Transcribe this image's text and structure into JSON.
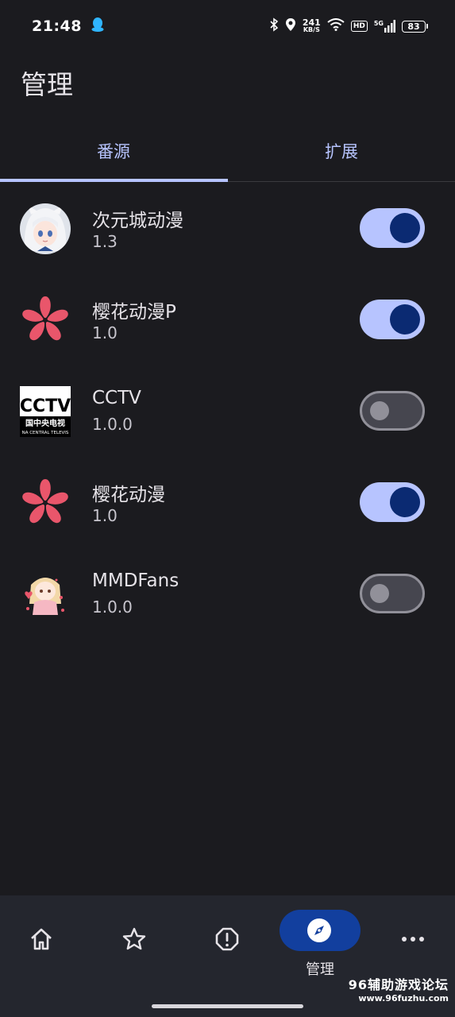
{
  "status_bar": {
    "time": "21:48",
    "net_speed_value": "241",
    "net_speed_unit": "KB/S",
    "hd_badge": "HD",
    "signal_label": "5G",
    "battery": "83"
  },
  "page": {
    "title": "管理"
  },
  "tabs": [
    {
      "label": "番源",
      "selected": true
    },
    {
      "label": "扩展",
      "selected": false
    }
  ],
  "sources": [
    {
      "name": "次元城动漫",
      "version": "1.3",
      "enabled": true,
      "icon": "anime-girl-avatar"
    },
    {
      "name": "樱花动漫P",
      "version": "1.0",
      "enabled": true,
      "icon": "sakura-flower-icon"
    },
    {
      "name": "CCTV",
      "version": "1.0.0",
      "enabled": false,
      "icon": "cctv-logo",
      "logo_text": [
        "CCTV",
        "国中央电视",
        "NA CENTRAL TELEVIS"
      ]
    },
    {
      "name": "樱花动漫",
      "version": "1.0",
      "enabled": true,
      "icon": "sakura-flower-icon"
    },
    {
      "name": "MMDFans",
      "version": "1.0.0",
      "enabled": false,
      "icon": "chibi-girl-avatar"
    }
  ],
  "bottom_nav": [
    {
      "icon": "home-icon",
      "label": ""
    },
    {
      "icon": "star-icon",
      "label": ""
    },
    {
      "icon": "alert-octagon-icon",
      "label": ""
    },
    {
      "icon": "compass-icon",
      "label": "管理",
      "active": true
    },
    {
      "icon": "more-icon",
      "label": ""
    }
  ],
  "watermark": {
    "line1": "96辅助游戏论坛",
    "line2": "www.96fuzhu.com"
  },
  "colors": {
    "background": "#1b1b1f",
    "accent": "#b7c4ff",
    "toggle_knob_on": "#0b2a72",
    "nav_background": "#24262e",
    "nav_active_pill": "#123f9e",
    "sakura": "#e9566b"
  }
}
